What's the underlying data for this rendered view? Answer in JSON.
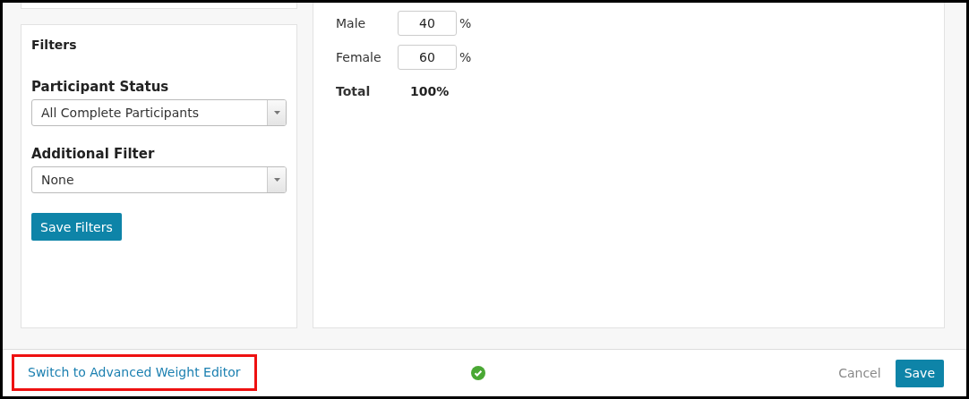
{
  "filters": {
    "title": "Filters",
    "fields": [
      {
        "label": "Participant Status",
        "value": "All Complete Participants"
      },
      {
        "label": "Additional Filter",
        "value": "None"
      }
    ],
    "button": "Save Filters"
  },
  "weights": {
    "rows": [
      {
        "label": "Male",
        "value": "40",
        "unit": "%"
      },
      {
        "label": "Female",
        "value": "60",
        "unit": "%"
      }
    ],
    "total": {
      "label": "Total",
      "value": "100%"
    }
  },
  "footer": {
    "link": "Switch to Advanced Weight Editor",
    "link_highlighted": true,
    "valid": true,
    "cancel": "Cancel",
    "save": "Save"
  }
}
